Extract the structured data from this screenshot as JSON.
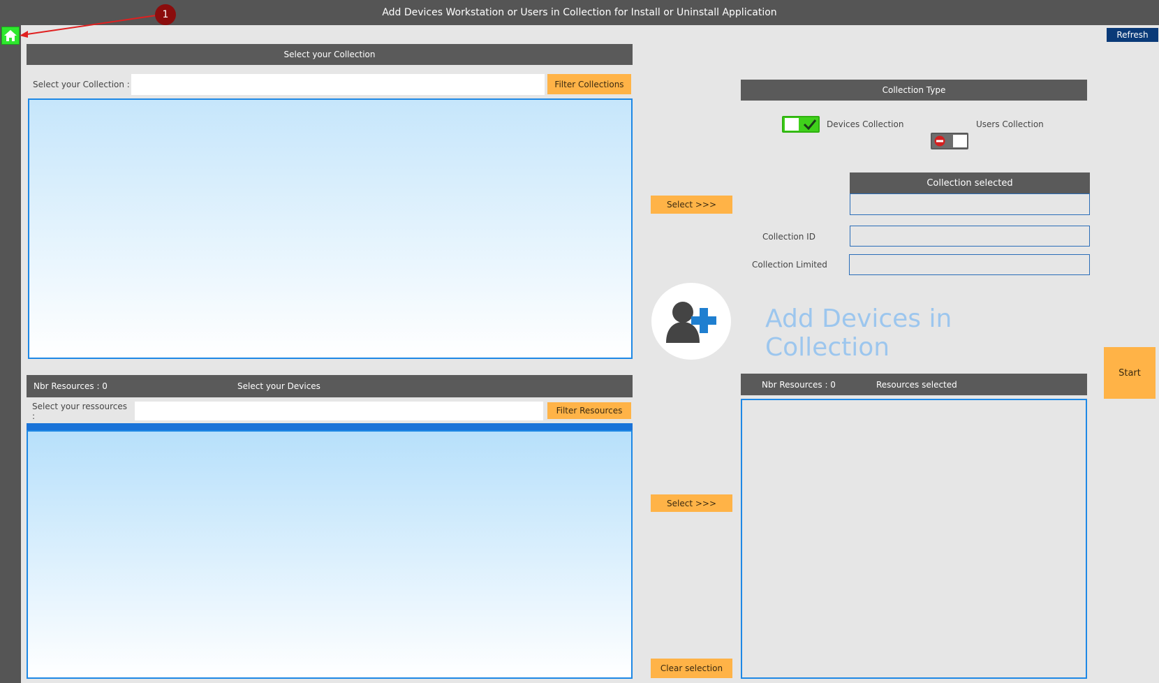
{
  "window": {
    "title": "Add Devices Workstation or Users in Collection for Install or Uninstall Application"
  },
  "annotation": {
    "badge": "1"
  },
  "toolbar": {
    "refresh_label": "Refresh"
  },
  "collection_panel": {
    "header": "Select your Collection",
    "label": "Select your Collection :",
    "input_value": "",
    "filter_label": "Filter Collections"
  },
  "devices_panel": {
    "nbr_resources": "Nbr Resources : 0",
    "header": "Select your Devices",
    "label": "Select your ressources :",
    "input_value": "",
    "filter_label": "Filter Resources"
  },
  "middle": {
    "select_label_1": "Select   >>>",
    "select_label_2": "Select   >>>",
    "clear_label": "Clear selection"
  },
  "collection_type": {
    "header": "Collection Type",
    "devices_label": "Devices Collection",
    "users_label": "Users Collection",
    "devices_on": true,
    "users_on": false
  },
  "collection_info": {
    "selected_header": "Collection selected",
    "selected_value": "",
    "id_label": "Collection ID",
    "id_value": "",
    "limited_label": "Collection Limited",
    "limited_value": ""
  },
  "action": {
    "title": "Add Devices in Collection",
    "start_label": "Start"
  },
  "resources_selected": {
    "nbr_resources": "Nbr Resources : 0",
    "header": "Resources selected"
  },
  "colors": {
    "accent_orange": "#ffb347",
    "dark_header": "#5a5a5a",
    "list_border": "#1e88e5",
    "toggle_on": "#3fd11b",
    "navy": "#0a3a78"
  },
  "icons": {
    "home": "home-icon",
    "add_user": "add-user-icon",
    "check": "check-icon",
    "no_entry": "no-entry-icon"
  }
}
